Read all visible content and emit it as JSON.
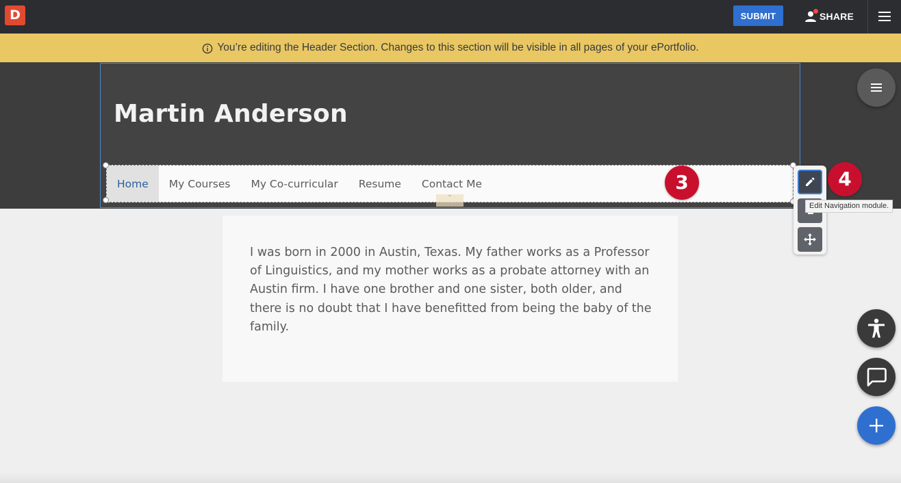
{
  "topbar": {
    "logo_letter": "D",
    "submit_label": "SUBMIT",
    "share_label": "SHARE"
  },
  "notice": {
    "text": "You’re editing the Header Section. Changes to this section will be visible in all pages of your ePortfolio."
  },
  "header": {
    "title": "Martin Anderson",
    "nav_items": [
      "Home",
      "My Courses",
      "My Co-curricular",
      "Resume",
      "Contact Me"
    ]
  },
  "annotations": {
    "badge_3": "3",
    "badge_4": "4"
  },
  "toolbar": {
    "tooltip": "Edit  Navigation module."
  },
  "content": {
    "paragraph": "I was born in 2000 in Austin, Texas. My father works as a Professor of Linguistics, and my mother works as a probate attorney with an Austin firm. I have one brother and one sister, both older, and there is no doubt that I have benefitted from being the baby of the family."
  },
  "icons": {
    "menu": "hamburger-icon",
    "person": "person-icon",
    "info": "info-icon",
    "edit": "pencil-icon",
    "move": "move-arrows-icon",
    "accessibility": "accessibility-icon",
    "chat": "chat-icon",
    "add": "plus-icon"
  },
  "colors": {
    "topbar": "#2b2d30",
    "brand": "#e04a32",
    "primary": "#2f6fd0",
    "notice": "#e9c763",
    "header": "#3d3d3d",
    "badge": "#c8102e",
    "active_nav_text": "#2b5ea0"
  }
}
